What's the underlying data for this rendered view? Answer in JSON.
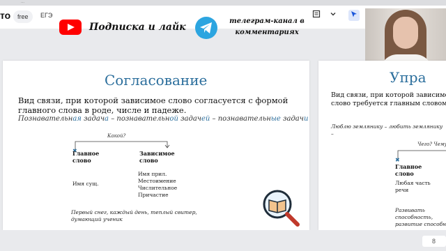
{
  "browser": {
    "url": "...",
    "logo_text": "то",
    "free_badge": "free",
    "tab_label": "ЕГЭ",
    "tools": [
      {
        "icon": "cursor-icon"
      },
      {
        "icon": "sticky-note-icon"
      },
      {
        "icon": "chevron-down-icon"
      },
      {
        "icon": "filter-icon"
      }
    ]
  },
  "overlay": {
    "youtube_text": "Подписка и лайк",
    "telegram_text": "телеграм-канал в комментариях",
    "youtube_color": "#ff0000",
    "telegram_color": "#2ca5e0"
  },
  "slide1": {
    "title": "Согласование",
    "definition": "Вид связи, при которой зависимое слово согласуется с формой главного слова в роде, числе и падеже.",
    "example_parts": [
      "Познавательн",
      "ая",
      " задач",
      "а",
      " – познавательн",
      "ой",
      " задач",
      "ей",
      " – познавательн",
      "ые",
      " задач",
      "и"
    ],
    "question": "Какой?",
    "main_label": "Главное слово",
    "dep_label": "Зависимое слово",
    "main_items": "Имя сущ.",
    "dep_items": [
      "Имя прил.",
      "Местоимение",
      "Числительное",
      "Причастие"
    ],
    "bottom_example": "Первый снег, каждый день, теплый свитер, думающий ученик"
  },
  "slide2": {
    "title": "Упра",
    "definition": "Вид связи, при которой зависимое слово требуется главным словом.",
    "example": "Люблю землянику – любить землянику –",
    "question": "Чего? Чему?",
    "main_label": "Главное слово",
    "main_items": "Любая часть речи",
    "bottom_example": "Развивать способность, развитие способност"
  },
  "footer": {
    "page_indicator": "8"
  },
  "colors": {
    "accent": "#2b6e9c",
    "slide_bg": "#ffffff",
    "canvas_bg": "#e9eaed"
  }
}
